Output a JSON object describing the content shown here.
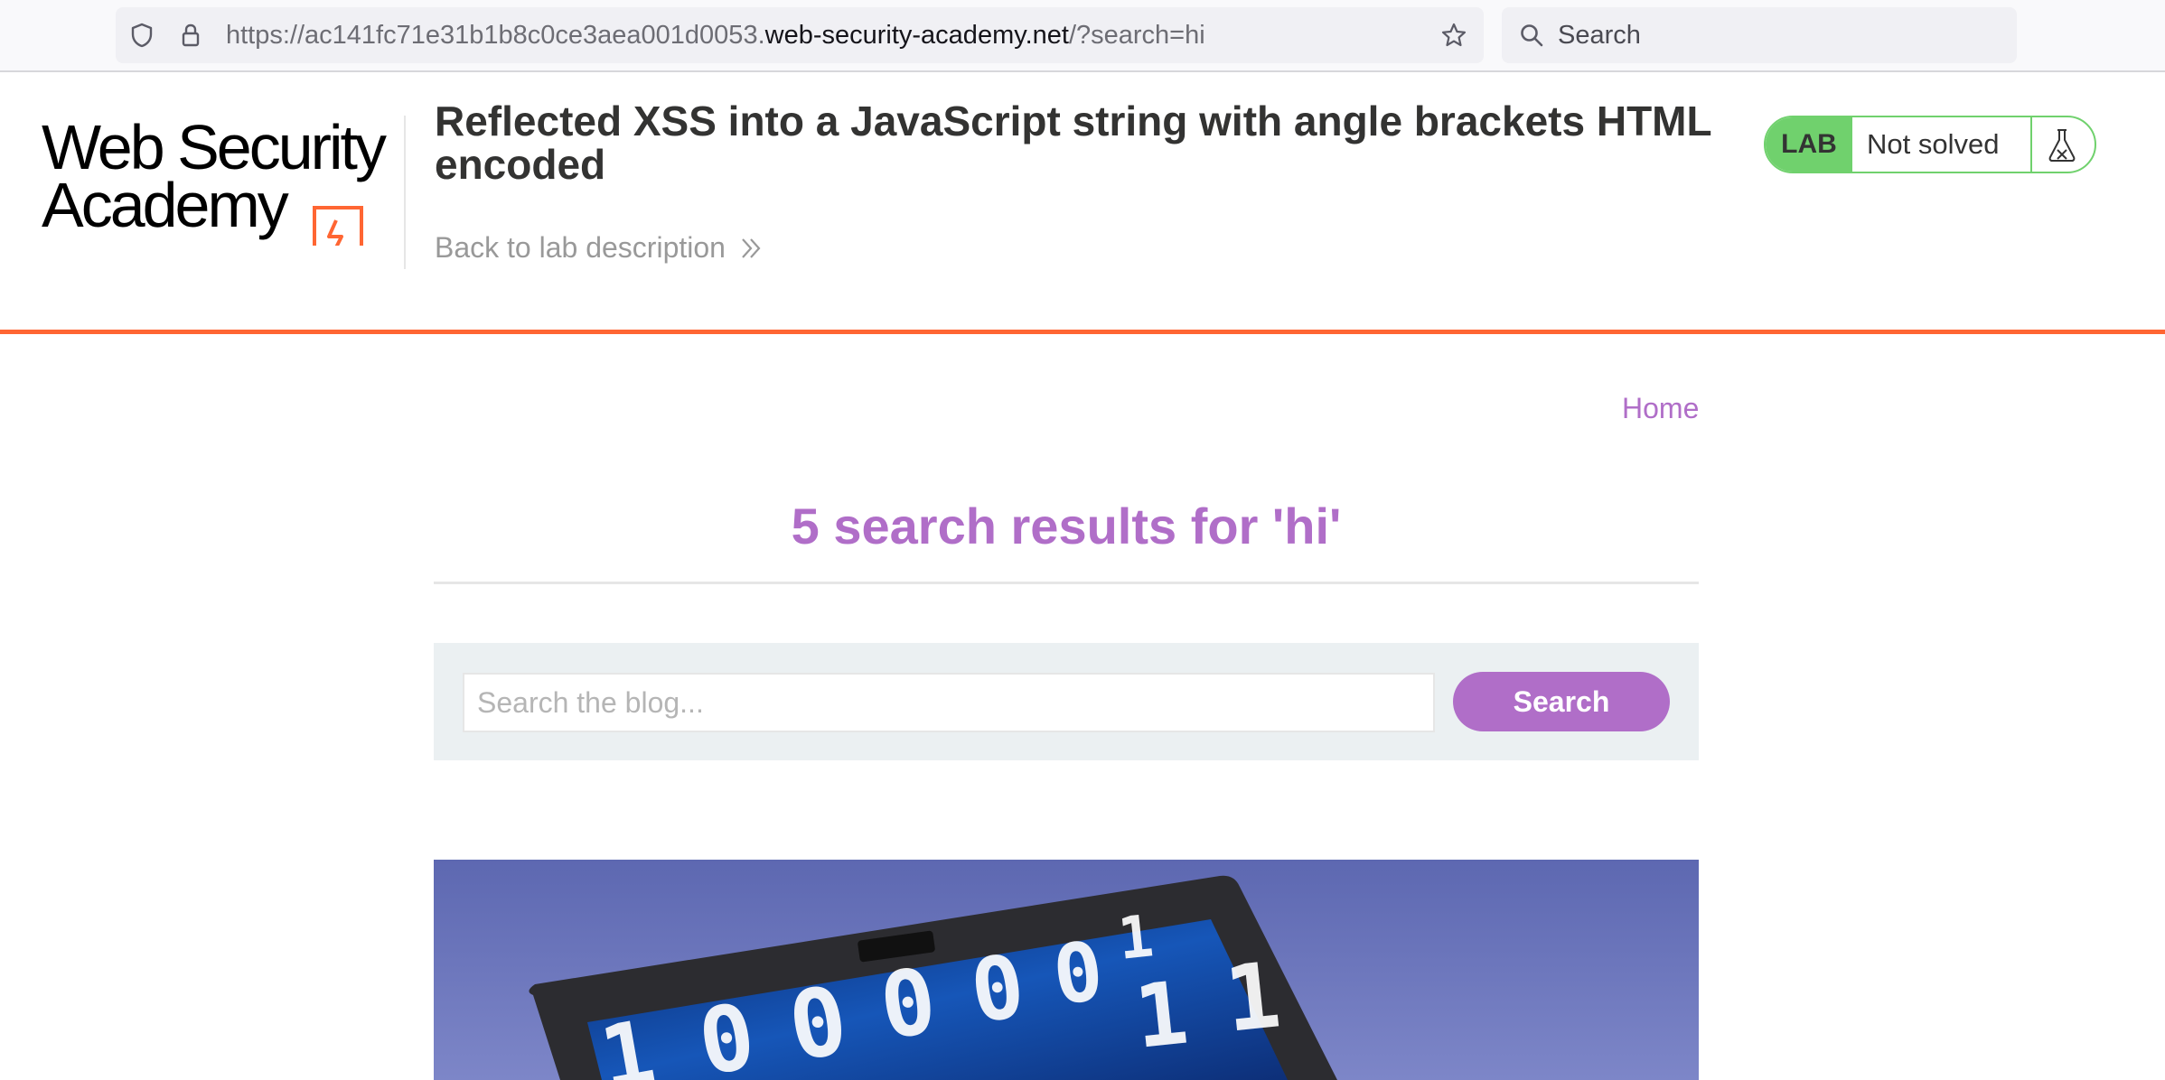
{
  "browser": {
    "url_prefix": "https://ac141fc71e31b1b8c0ce3aea001d0053.",
    "url_host": "web-security-academy.net",
    "url_suffix": "/?search=hi",
    "search_placeholder": "Search"
  },
  "header": {
    "logo_line1": "Web Security",
    "logo_line2": "Academy",
    "lab_title": "Reflected XSS into a JavaScript string with angle brackets HTML encoded",
    "back_link": "Back to lab description",
    "status_badge": "LAB",
    "status_text": "Not solved"
  },
  "nav": {
    "home": "Home"
  },
  "results": {
    "heading": "5 search results for 'hi'"
  },
  "search": {
    "placeholder": "Search the blog...",
    "button": "Search"
  },
  "colors": {
    "accent": "#b06ec8",
    "brand_orange": "#ff6633",
    "status_green": "#70d16d",
    "search_box_bg": "#ebf0f2"
  },
  "icons": {
    "urlbar": [
      "shield-icon",
      "lock-icon",
      "star-icon"
    ],
    "searchbar": "search-icon",
    "back": "double-chevron-right-icon",
    "status": "flask-icon"
  }
}
